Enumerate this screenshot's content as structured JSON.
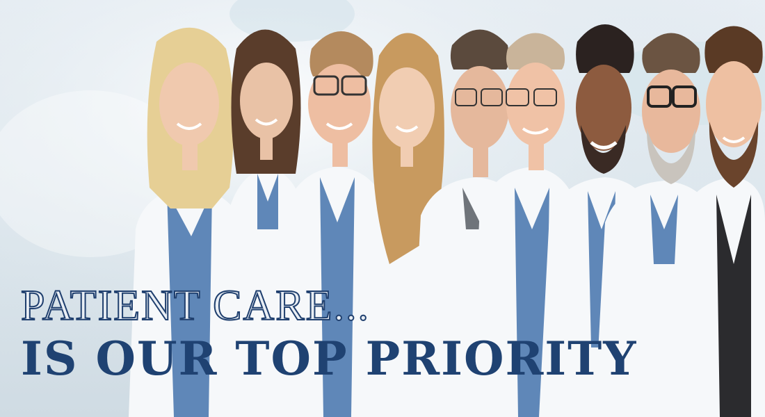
{
  "banner": {
    "headline_line1": "PATIENT CARE...",
    "headline_line2": "IS OUR TOP PRIORITY",
    "colors": {
      "navy": "#1f4272",
      "coat_white": "#f6f8fa",
      "scrubs_blue": "#5f87b8",
      "background": "#dfe8ee"
    }
  }
}
